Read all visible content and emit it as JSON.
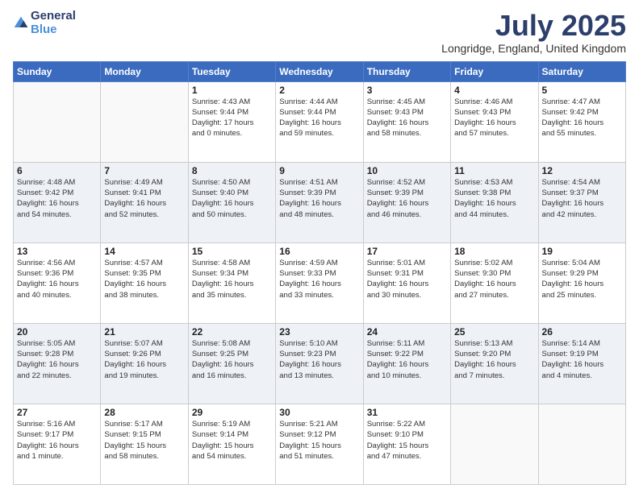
{
  "logo": {
    "general": "General",
    "blue": "Blue"
  },
  "title": "July 2025",
  "location": "Longridge, England, United Kingdom",
  "days_of_week": [
    "Sunday",
    "Monday",
    "Tuesday",
    "Wednesday",
    "Thursday",
    "Friday",
    "Saturday"
  ],
  "weeks": [
    [
      {
        "day": "",
        "info": ""
      },
      {
        "day": "",
        "info": ""
      },
      {
        "day": "1",
        "info": "Sunrise: 4:43 AM\nSunset: 9:44 PM\nDaylight: 17 hours\nand 0 minutes."
      },
      {
        "day": "2",
        "info": "Sunrise: 4:44 AM\nSunset: 9:44 PM\nDaylight: 16 hours\nand 59 minutes."
      },
      {
        "day": "3",
        "info": "Sunrise: 4:45 AM\nSunset: 9:43 PM\nDaylight: 16 hours\nand 58 minutes."
      },
      {
        "day": "4",
        "info": "Sunrise: 4:46 AM\nSunset: 9:43 PM\nDaylight: 16 hours\nand 57 minutes."
      },
      {
        "day": "5",
        "info": "Sunrise: 4:47 AM\nSunset: 9:42 PM\nDaylight: 16 hours\nand 55 minutes."
      }
    ],
    [
      {
        "day": "6",
        "info": "Sunrise: 4:48 AM\nSunset: 9:42 PM\nDaylight: 16 hours\nand 54 minutes."
      },
      {
        "day": "7",
        "info": "Sunrise: 4:49 AM\nSunset: 9:41 PM\nDaylight: 16 hours\nand 52 minutes."
      },
      {
        "day": "8",
        "info": "Sunrise: 4:50 AM\nSunset: 9:40 PM\nDaylight: 16 hours\nand 50 minutes."
      },
      {
        "day": "9",
        "info": "Sunrise: 4:51 AM\nSunset: 9:39 PM\nDaylight: 16 hours\nand 48 minutes."
      },
      {
        "day": "10",
        "info": "Sunrise: 4:52 AM\nSunset: 9:39 PM\nDaylight: 16 hours\nand 46 minutes."
      },
      {
        "day": "11",
        "info": "Sunrise: 4:53 AM\nSunset: 9:38 PM\nDaylight: 16 hours\nand 44 minutes."
      },
      {
        "day": "12",
        "info": "Sunrise: 4:54 AM\nSunset: 9:37 PM\nDaylight: 16 hours\nand 42 minutes."
      }
    ],
    [
      {
        "day": "13",
        "info": "Sunrise: 4:56 AM\nSunset: 9:36 PM\nDaylight: 16 hours\nand 40 minutes."
      },
      {
        "day": "14",
        "info": "Sunrise: 4:57 AM\nSunset: 9:35 PM\nDaylight: 16 hours\nand 38 minutes."
      },
      {
        "day": "15",
        "info": "Sunrise: 4:58 AM\nSunset: 9:34 PM\nDaylight: 16 hours\nand 35 minutes."
      },
      {
        "day": "16",
        "info": "Sunrise: 4:59 AM\nSunset: 9:33 PM\nDaylight: 16 hours\nand 33 minutes."
      },
      {
        "day": "17",
        "info": "Sunrise: 5:01 AM\nSunset: 9:31 PM\nDaylight: 16 hours\nand 30 minutes."
      },
      {
        "day": "18",
        "info": "Sunrise: 5:02 AM\nSunset: 9:30 PM\nDaylight: 16 hours\nand 27 minutes."
      },
      {
        "day": "19",
        "info": "Sunrise: 5:04 AM\nSunset: 9:29 PM\nDaylight: 16 hours\nand 25 minutes."
      }
    ],
    [
      {
        "day": "20",
        "info": "Sunrise: 5:05 AM\nSunset: 9:28 PM\nDaylight: 16 hours\nand 22 minutes."
      },
      {
        "day": "21",
        "info": "Sunrise: 5:07 AM\nSunset: 9:26 PM\nDaylight: 16 hours\nand 19 minutes."
      },
      {
        "day": "22",
        "info": "Sunrise: 5:08 AM\nSunset: 9:25 PM\nDaylight: 16 hours\nand 16 minutes."
      },
      {
        "day": "23",
        "info": "Sunrise: 5:10 AM\nSunset: 9:23 PM\nDaylight: 16 hours\nand 13 minutes."
      },
      {
        "day": "24",
        "info": "Sunrise: 5:11 AM\nSunset: 9:22 PM\nDaylight: 16 hours\nand 10 minutes."
      },
      {
        "day": "25",
        "info": "Sunrise: 5:13 AM\nSunset: 9:20 PM\nDaylight: 16 hours\nand 7 minutes."
      },
      {
        "day": "26",
        "info": "Sunrise: 5:14 AM\nSunset: 9:19 PM\nDaylight: 16 hours\nand 4 minutes."
      }
    ],
    [
      {
        "day": "27",
        "info": "Sunrise: 5:16 AM\nSunset: 9:17 PM\nDaylight: 16 hours\nand 1 minute."
      },
      {
        "day": "28",
        "info": "Sunrise: 5:17 AM\nSunset: 9:15 PM\nDaylight: 15 hours\nand 58 minutes."
      },
      {
        "day": "29",
        "info": "Sunrise: 5:19 AM\nSunset: 9:14 PM\nDaylight: 15 hours\nand 54 minutes."
      },
      {
        "day": "30",
        "info": "Sunrise: 5:21 AM\nSunset: 9:12 PM\nDaylight: 15 hours\nand 51 minutes."
      },
      {
        "day": "31",
        "info": "Sunrise: 5:22 AM\nSunset: 9:10 PM\nDaylight: 15 hours\nand 47 minutes."
      },
      {
        "day": "",
        "info": ""
      },
      {
        "day": "",
        "info": ""
      }
    ]
  ]
}
